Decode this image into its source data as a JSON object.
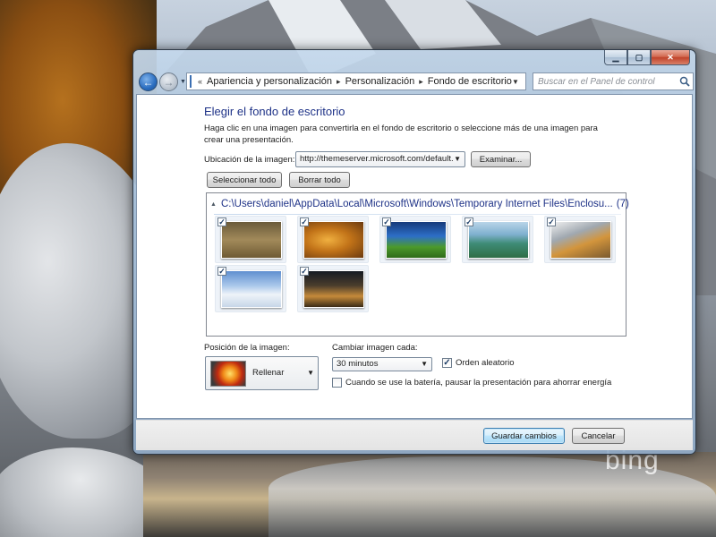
{
  "wallpaper": {
    "watermark": "bing"
  },
  "window": {
    "controls": {
      "minimize": "▁",
      "maximize": "▢",
      "close": "✕"
    }
  },
  "address_bar": {
    "overflow": "«",
    "crumbs": [
      "Apariencia y personalización",
      "Personalización",
      "Fondo de escritorio"
    ],
    "separator": "▸",
    "search_placeholder": "Buscar en el Panel de control"
  },
  "page": {
    "title": "Elegir el fondo de escritorio",
    "description": "Haga clic en una imagen para convertirla en el fondo de escritorio o seleccione más de una imagen para crear una presentación.",
    "location_label": "Ubicación de la imagen:",
    "location_value": "http://themeserver.microsoft.com/default.",
    "browse_button": "Examinar...",
    "select_all_button": "Seleccionar todo",
    "clear_all_button": "Borrar todo"
  },
  "image_list": {
    "group_path": "C:\\Users\\daniel\\AppData\\Local\\Microsoft\\Windows\\Temporary Internet Files\\Enclosu...",
    "group_count": "(7)",
    "check_mark": "✓",
    "images": [
      {
        "theme": "animals-savanna",
        "checked": true
      },
      {
        "theme": "autumn-leaves",
        "checked": true
      },
      {
        "theme": "waterfall-night",
        "checked": true
      },
      {
        "theme": "green-coast",
        "checked": true
      },
      {
        "theme": "mountain-canyon",
        "checked": true
      },
      {
        "theme": "snow-dunes",
        "checked": true
      },
      {
        "theme": "stone-bridge",
        "checked": true
      }
    ]
  },
  "options": {
    "position_label": "Posición de la imagen:",
    "position_value": "Rellenar",
    "interval_label": "Cambiar imagen cada:",
    "interval_value": "30 minutos",
    "shuffle_label": "Orden aleatorio",
    "shuffle_checked": true,
    "battery_label": "Cuando se use la batería, pausar la presentación para ahorrar energía",
    "battery_checked": false
  },
  "footer": {
    "save_button": "Guardar cambios",
    "cancel_button": "Cancelar"
  }
}
